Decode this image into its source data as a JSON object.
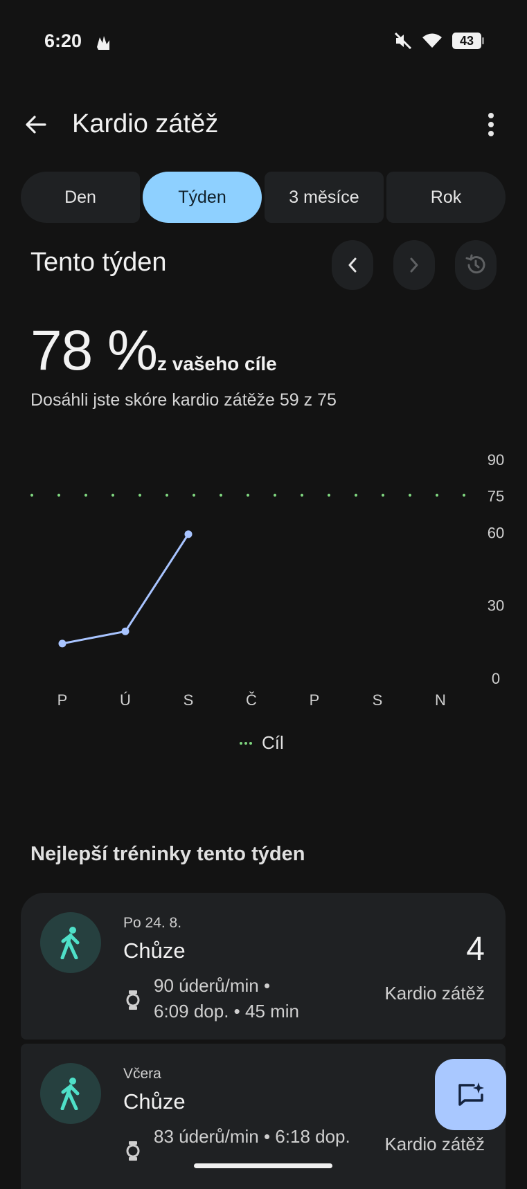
{
  "status_bar": {
    "time": "6:20",
    "notification_icon": "gesture-hands-icon",
    "mute_icon": "volume-off-icon",
    "wifi_icon": "wifi-icon",
    "battery": "43"
  },
  "app_bar": {
    "title": "Kardio zátěž",
    "back_icon": "arrow-back-icon",
    "more_icon": "more-vert-icon"
  },
  "tabs": [
    {
      "label": "Den",
      "active": false
    },
    {
      "label": "Týden",
      "active": true
    },
    {
      "label": "3 měsíce",
      "active": false
    },
    {
      "label": "Rok",
      "active": false
    }
  ],
  "period": {
    "title": "Tento týden",
    "prev_icon": "chevron-left-icon",
    "next_icon": "chevron-right-icon",
    "reset_icon": "history-icon"
  },
  "summary": {
    "percent": "78 %",
    "percent_suffix": "z vašeho cíle",
    "text": "Dosáhli jste skóre kardio zátěže 59 z 75"
  },
  "chart_data": {
    "type": "line",
    "categories": [
      "P",
      "Ú",
      "S",
      "Č",
      "P",
      "S",
      "N"
    ],
    "series": [
      {
        "name": "",
        "values": [
          14,
          19,
          59,
          null,
          null,
          null,
          null
        ],
        "color": "#a8c4ff"
      }
    ],
    "goal": {
      "name": "Cíl",
      "value": 75,
      "color": "#7fd67f"
    },
    "yticks": [
      0,
      30,
      60,
      75,
      90
    ],
    "ylim": [
      0,
      90
    ],
    "grid": false
  },
  "legend": {
    "goal_label": "Cíl"
  },
  "best_workouts": {
    "title": "Nejlepší tréninky tento týden",
    "items": [
      {
        "date": "Po 24. 8.",
        "name": "Chůze",
        "detail_line1": "90 úderů/min •",
        "detail_line2": "6:09 dop. • 45 min",
        "score": "4",
        "score_label": "Kardio zátěž",
        "icon": "walking-icon",
        "device_icon": "watch-icon"
      },
      {
        "date": "Včera",
        "name": "Chůze",
        "detail_line1": "83 úderů/min • 6:18 dop.",
        "detail_line2": "",
        "score": "",
        "score_label": "Kardio zátěž",
        "icon": "walking-icon",
        "device_icon": "watch-icon"
      }
    ]
  },
  "fab": {
    "icon": "chat-sparkle-icon"
  },
  "colors": {
    "background": "#131313",
    "surface": "#1f2123",
    "accent_tab": "#8ed0ff",
    "line": "#a8c4ff",
    "goal": "#7fd67f",
    "fab": "#a9c8ff"
  }
}
